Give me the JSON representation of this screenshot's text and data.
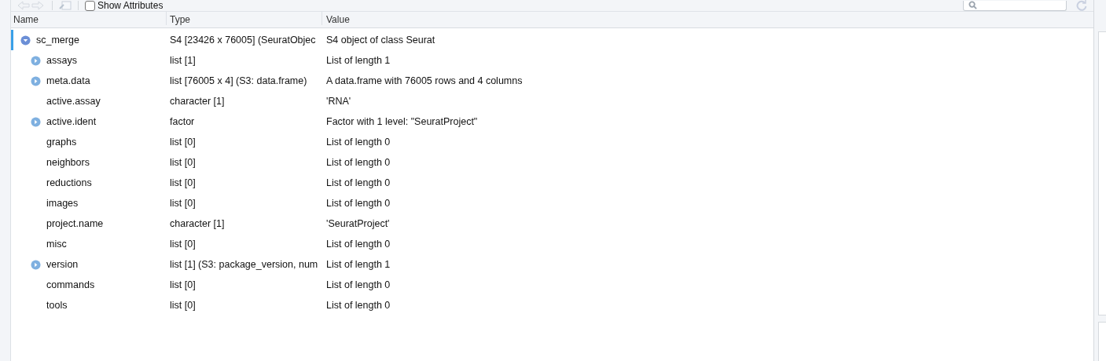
{
  "toolbar": {
    "show_attributes": {
      "label": "Show Attributes",
      "checked": false
    }
  },
  "table": {
    "columns": [
      "Name",
      "Type",
      "Value"
    ],
    "rows": [
      {
        "name": "sc_merge",
        "type": "S4 [23426 x 76005] (SeuratObjec",
        "value": "S4 object of class Seurat",
        "selected": true,
        "expanded": true,
        "children": [
          {
            "name": "assays",
            "type": "list [1]",
            "value": "List of length 1",
            "selected": false,
            "expanded": false
          },
          {
            "name": "meta.data",
            "type": "list [76005 x 4] (S3: data.frame)",
            "value": "A data.frame with 76005 rows and 4 columns",
            "selected": false,
            "expanded": false
          },
          {
            "name": "active.assay",
            "type": "character [1]",
            "value": "'RNA'",
            "selected": false
          },
          {
            "name": "active.ident",
            "type": "factor",
            "value": "Factor with 1 level: \"SeuratProject\"",
            "selected": false,
            "expanded": false
          },
          {
            "name": "graphs",
            "type": "list [0]",
            "value": "List of length 0",
            "selected": false
          },
          {
            "name": "neighbors",
            "type": "list [0]",
            "value": "List of length 0",
            "selected": false
          },
          {
            "name": "reductions",
            "type": "list [0]",
            "value": "List of length 0",
            "selected": false
          },
          {
            "name": "images",
            "type": "list [0]",
            "value": "List of length 0",
            "selected": false
          },
          {
            "name": "project.name",
            "type": "character [1]",
            "value": "'SeuratProject'",
            "selected": false
          },
          {
            "name": "misc",
            "type": "list [0]",
            "value": "List of length 0",
            "selected": false
          },
          {
            "name": "version",
            "type": "list [1] (S3: package_version, num",
            "value": "List of length 1",
            "selected": false,
            "expanded": false
          },
          {
            "name": "commands",
            "type": "list [0]",
            "value": "List of length 0",
            "selected": false
          },
          {
            "name": "tools",
            "type": "list [0]",
            "value": "List of length 0",
            "selected": false
          }
        ]
      }
    ]
  }
}
